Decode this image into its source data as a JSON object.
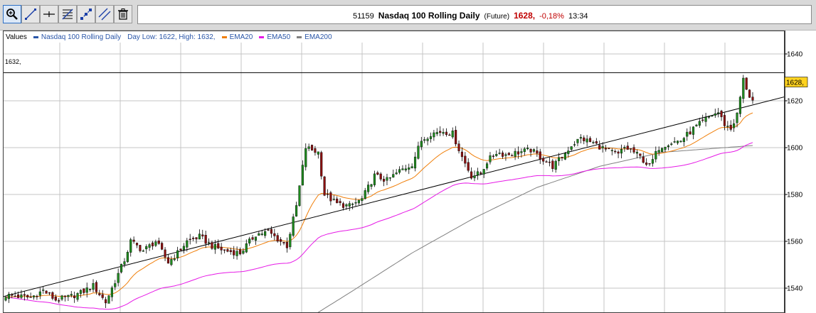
{
  "toolbar": {
    "tools": [
      {
        "name": "zoom-tool-icon",
        "label": "zoom"
      },
      {
        "name": "line-tool-icon",
        "label": "draw line"
      },
      {
        "name": "horizontal-line-tool-icon",
        "label": "horizontal line"
      },
      {
        "name": "fibonacci-tool-icon",
        "label": "fibonacci"
      },
      {
        "name": "trend-tool-icon",
        "label": "trend"
      },
      {
        "name": "parallel-tool-icon",
        "label": "parallel lines"
      },
      {
        "name": "trash-icon",
        "label": "delete"
      }
    ]
  },
  "header": {
    "id": "51159",
    "title": "Nasdaq 100 Rolling Daily",
    "type": "(Future)",
    "price": "1628,",
    "change": "-0,18%",
    "time": "13:34"
  },
  "legend": {
    "values_label": "Values",
    "items": [
      {
        "key": "price",
        "label": "Nasdaq 100 Rolling Daily",
        "color": "#2a56a8"
      },
      {
        "key": "range",
        "label": "Day Low: 1622, High: 1632,",
        "color": "#2a56a8"
      },
      {
        "key": "ema20",
        "label": "EMA20",
        "color": "#f07f0a"
      },
      {
        "key": "ema50",
        "label": "EMA50",
        "color": "#e619e6"
      },
      {
        "key": "ema200",
        "label": "EMA200",
        "color": "#808080"
      }
    ]
  },
  "hline": {
    "value": 1632,
    "label": "1632,"
  },
  "last_price_tag": "1628,",
  "colors": {
    "up": "#1e8a1e",
    "down": "#8b1010",
    "ema20": "#f07f0a",
    "ema50": "#e619e6",
    "ema200": "#808080"
  },
  "chart_data": {
    "type": "candlestick",
    "title": "Nasdaq 100 Rolling Daily",
    "ylim": [
      1530,
      1645
    ],
    "y_ticks": [
      1540,
      1560,
      1580,
      1600,
      1620,
      1640
    ],
    "grid": true,
    "bar_count": 240,
    "close_anchors": [
      [
        0,
        1537
      ],
      [
        8,
        1536
      ],
      [
        12,
        1539
      ],
      [
        16,
        1535
      ],
      [
        20,
        1536
      ],
      [
        24,
        1538
      ],
      [
        28,
        1541
      ],
      [
        32,
        1534
      ],
      [
        38,
        1552
      ],
      [
        40,
        1560
      ],
      [
        44,
        1556
      ],
      [
        48,
        1560
      ],
      [
        52,
        1551
      ],
      [
        55,
        1555
      ],
      [
        58,
        1560
      ],
      [
        62,
        1562
      ],
      [
        66,
        1558
      ],
      [
        70,
        1556
      ],
      [
        75,
        1555
      ],
      [
        80,
        1563
      ],
      [
        84,
        1564
      ],
      [
        86,
        1562
      ],
      [
        90,
        1558
      ],
      [
        93,
        1575
      ],
      [
        96,
        1600
      ],
      [
        100,
        1598
      ],
      [
        102,
        1580
      ],
      [
        106,
        1576
      ],
      [
        110,
        1575
      ],
      [
        114,
        1578
      ],
      [
        118,
        1588
      ],
      [
        122,
        1586
      ],
      [
        126,
        1590
      ],
      [
        130,
        1593
      ],
      [
        133,
        1603
      ],
      [
        136,
        1606
      ],
      [
        140,
        1607
      ],
      [
        143,
        1606
      ],
      [
        146,
        1596
      ],
      [
        149,
        1588
      ],
      [
        152,
        1589
      ],
      [
        154,
        1594
      ],
      [
        157,
        1598
      ],
      [
        160,
        1597
      ],
      [
        164,
        1598
      ],
      [
        168,
        1599
      ],
      [
        172,
        1595
      ],
      [
        175,
        1592
      ],
      [
        178,
        1596
      ],
      [
        181,
        1601
      ],
      [
        184,
        1604
      ],
      [
        188,
        1602
      ],
      [
        192,
        1599
      ],
      [
        196,
        1597
      ],
      [
        198,
        1600
      ],
      [
        200,
        1599
      ],
      [
        203,
        1596
      ],
      [
        206,
        1592
      ],
      [
        209,
        1600
      ],
      [
        212,
        1602
      ],
      [
        216,
        1603
      ],
      [
        220,
        1608
      ],
      [
        224,
        1612
      ],
      [
        226,
        1614
      ],
      [
        228,
        1615
      ],
      [
        230,
        1610
      ],
      [
        232,
        1608
      ],
      [
        234,
        1614
      ],
      [
        236,
        1629
      ],
      [
        238,
        1622
      ],
      [
        240,
        1618
      ]
    ],
    "ema200_anchors": [
      [
        92,
        1523
      ],
      [
        110,
        1538
      ],
      [
        130,
        1555
      ],
      [
        150,
        1570
      ],
      [
        170,
        1583
      ],
      [
        190,
        1592
      ],
      [
        210,
        1598
      ],
      [
        240,
        1601
      ]
    ],
    "trendline": [
      [
        -2,
        1536
      ],
      [
        256,
        1624
      ]
    ]
  }
}
